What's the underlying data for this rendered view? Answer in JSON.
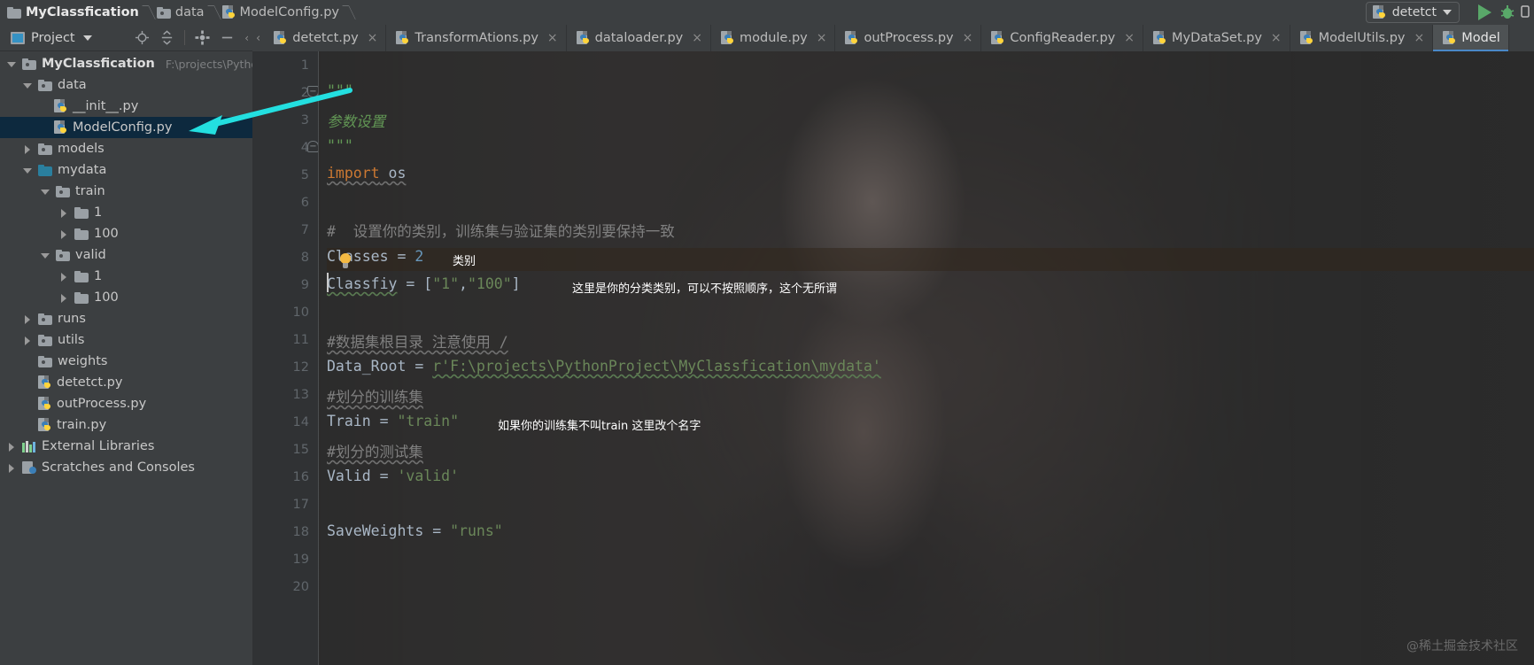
{
  "window": {
    "breadcrumbs": [
      {
        "label": "MyClassfication",
        "icon": "module-icon"
      },
      {
        "label": "data",
        "icon": "folder-icon"
      },
      {
        "label": "ModelConfig.py",
        "icon": "python-file-icon"
      }
    ],
    "run_config": {
      "label": "detetct",
      "icon": "python-file-icon"
    },
    "run_button": "run-icon",
    "debug_button": "debug-icon"
  },
  "tool_window": {
    "title": "Project",
    "icons": [
      "locate-icon",
      "collapse-all-icon",
      "settings-icon",
      "hide-icon"
    ]
  },
  "tree": [
    {
      "label": "MyClassfication",
      "path": "F:\\projects\\PythonProject",
      "indent": 0,
      "arrow": "down",
      "icon": "folder-icon",
      "bold": true,
      "selected": false
    },
    {
      "label": "data",
      "path": "",
      "indent": 1,
      "arrow": "down",
      "icon": "folder-icon",
      "bold": false,
      "selected": false
    },
    {
      "label": "__init__.py",
      "path": "",
      "indent": 2,
      "arrow": "none",
      "icon": "python-file-icon",
      "bold": false,
      "selected": false
    },
    {
      "label": "ModelConfig.py",
      "path": "",
      "indent": 2,
      "arrow": "none",
      "icon": "python-file-icon",
      "bold": false,
      "selected": true
    },
    {
      "label": "models",
      "path": "",
      "indent": 1,
      "arrow": "right",
      "icon": "folder-icon",
      "bold": false,
      "selected": false
    },
    {
      "label": "mydata",
      "path": "",
      "indent": 1,
      "arrow": "down",
      "icon": "folder-teal-icon",
      "bold": false,
      "selected": false
    },
    {
      "label": "train",
      "path": "",
      "indent": 2,
      "arrow": "down",
      "icon": "folder-icon",
      "bold": false,
      "selected": false
    },
    {
      "label": "1",
      "path": "",
      "indent": 3,
      "arrow": "right",
      "icon": "folder-plain-icon",
      "bold": false,
      "selected": false
    },
    {
      "label": "100",
      "path": "",
      "indent": 3,
      "arrow": "right",
      "icon": "folder-plain-icon",
      "bold": false,
      "selected": false
    },
    {
      "label": "valid",
      "path": "",
      "indent": 2,
      "arrow": "down",
      "icon": "folder-icon",
      "bold": false,
      "selected": false
    },
    {
      "label": "1",
      "path": "",
      "indent": 3,
      "arrow": "right",
      "icon": "folder-plain-icon",
      "bold": false,
      "selected": false
    },
    {
      "label": "100",
      "path": "",
      "indent": 3,
      "arrow": "right",
      "icon": "folder-plain-icon",
      "bold": false,
      "selected": false
    },
    {
      "label": "runs",
      "path": "",
      "indent": 1,
      "arrow": "right",
      "icon": "folder-icon",
      "bold": false,
      "selected": false
    },
    {
      "label": "utils",
      "path": "",
      "indent": 1,
      "arrow": "right",
      "icon": "folder-icon",
      "bold": false,
      "selected": false
    },
    {
      "label": "weights",
      "path": "",
      "indent": 1,
      "arrow": "none",
      "icon": "folder-icon",
      "bold": false,
      "selected": false
    },
    {
      "label": "detetct.py",
      "path": "",
      "indent": 1,
      "arrow": "none",
      "icon": "python-file-icon",
      "bold": false,
      "selected": false
    },
    {
      "label": "outProcess.py",
      "path": "",
      "indent": 1,
      "arrow": "none",
      "icon": "python-file-icon",
      "bold": false,
      "selected": false
    },
    {
      "label": "train.py",
      "path": "",
      "indent": 1,
      "arrow": "none",
      "icon": "python-file-icon",
      "bold": false,
      "selected": false
    },
    {
      "label": "External Libraries",
      "path": "",
      "indent": 0,
      "arrow": "right",
      "icon": "library-icon",
      "bold": false,
      "selected": false
    },
    {
      "label": "Scratches and Consoles",
      "path": "",
      "indent": 0,
      "arrow": "right",
      "icon": "scratches-icon",
      "bold": false,
      "selected": false
    }
  ],
  "tabs": [
    {
      "label": "detetct.py",
      "close": "×",
      "active": false
    },
    {
      "label": "TransformAtions.py",
      "close": "×",
      "active": false
    },
    {
      "label": "dataloader.py",
      "close": "×",
      "active": false
    },
    {
      "label": "module.py",
      "close": "×",
      "active": false
    },
    {
      "label": "outProcess.py",
      "close": "×",
      "active": false
    },
    {
      "label": "ConfigReader.py",
      "close": "×",
      "active": false
    },
    {
      "label": "MyDataSet.py",
      "close": "×",
      "active": false
    },
    {
      "label": "ModelUtils.py",
      "close": "×",
      "active": false
    },
    {
      "label": "Model",
      "close": "",
      "active": true
    }
  ],
  "editor": {
    "line_numbers": [
      "1",
      "2",
      "3",
      "4",
      "5",
      "6",
      "7",
      "8",
      "9",
      "10",
      "11",
      "12",
      "13",
      "14",
      "15",
      "16",
      "17",
      "18",
      "19",
      "20"
    ],
    "lines": [
      {
        "n": 1,
        "text": ""
      },
      {
        "n": 2,
        "text": "\"\"\""
      },
      {
        "n": 3,
        "text": "参数设置"
      },
      {
        "n": 4,
        "text": "\"\"\""
      },
      {
        "n": 5,
        "text": "import os"
      },
      {
        "n": 6,
        "text": ""
      },
      {
        "n": 7,
        "text": "#  设置你的类别，训练集与验证集的类别要保持一致"
      },
      {
        "n": 8,
        "text": "Classes = 2"
      },
      {
        "n": 9,
        "text": "Classfiy = [\"1\",\"100\"]"
      },
      {
        "n": 10,
        "text": ""
      },
      {
        "n": 11,
        "text": "#数据集根目录 注意使用 /"
      },
      {
        "n": 12,
        "text": "Data_Root = r'F:\\projects\\PythonProject\\MyClassfication\\mydata'"
      },
      {
        "n": 13,
        "text": "#划分的训练集"
      },
      {
        "n": 14,
        "text": "Train = \"train\""
      },
      {
        "n": 15,
        "text": "#划分的测试集"
      },
      {
        "n": 16,
        "text": "Valid = 'valid'"
      },
      {
        "n": 17,
        "text": ""
      },
      {
        "n": 18,
        "text": "SaveWeights = \"runs\""
      },
      {
        "n": 19,
        "text": ""
      },
      {
        "n": 20,
        "text": ""
      }
    ],
    "tokens": {
      "docquote_open": "\"\"\"",
      "doctext": "参数设置",
      "docquote_close": "\"\"\"",
      "import_kw": "import",
      "import_mod": " os",
      "comment7": "#  设置你的类别，训练集与验证集的类别要保持一致",
      "classes_name": "Classes",
      "classes_eq": " = ",
      "classes_val": "2",
      "classfiy_name": "Classfiy",
      "classfiy_eq": " = [",
      "classfiy_v1": "\"1\"",
      "classfiy_comma": ",",
      "classfiy_v2": "\"100\"",
      "classfiy_close": "]",
      "comment11": "#数据集根目录 注意使用 /",
      "dataroot_name": "Data_Root",
      "dataroot_eq": " = ",
      "dataroot_val": "r'F:\\projects\\PythonProject\\MyClassfication\\mydata'",
      "comment13": "#划分的训练集",
      "train_name": "Train",
      "train_eq": " = ",
      "train_val": "\"train\"",
      "comment15": "#划分的测试集",
      "valid_name": "Valid",
      "valid_eq": " = ",
      "valid_val": "'valid'",
      "saveweights_name": "SaveWeights",
      "saveweights_eq": " = ",
      "saveweights_val": "\"runs\""
    },
    "annotations": [
      {
        "id": "classes",
        "text": "类别"
      },
      {
        "id": "classfiy",
        "text": "这里是你的分类类别，可以不按照顺序，这个无所谓"
      },
      {
        "id": "train",
        "text": "如果你的训练集不叫train 这里改个名字"
      }
    ]
  },
  "watermark": "@稀土掘金技术社区",
  "colors": {
    "accent_cyan": "#23dfe0",
    "selection_blue": "#0d293e",
    "editor_bg": "#2b2b2b",
    "panel_bg": "#3c3f41",
    "string_green": "#6a8759",
    "number_blue": "#6897bb",
    "keyword_orange": "#cc7832",
    "doc_green": "#629755",
    "run_green": "#59a869"
  }
}
